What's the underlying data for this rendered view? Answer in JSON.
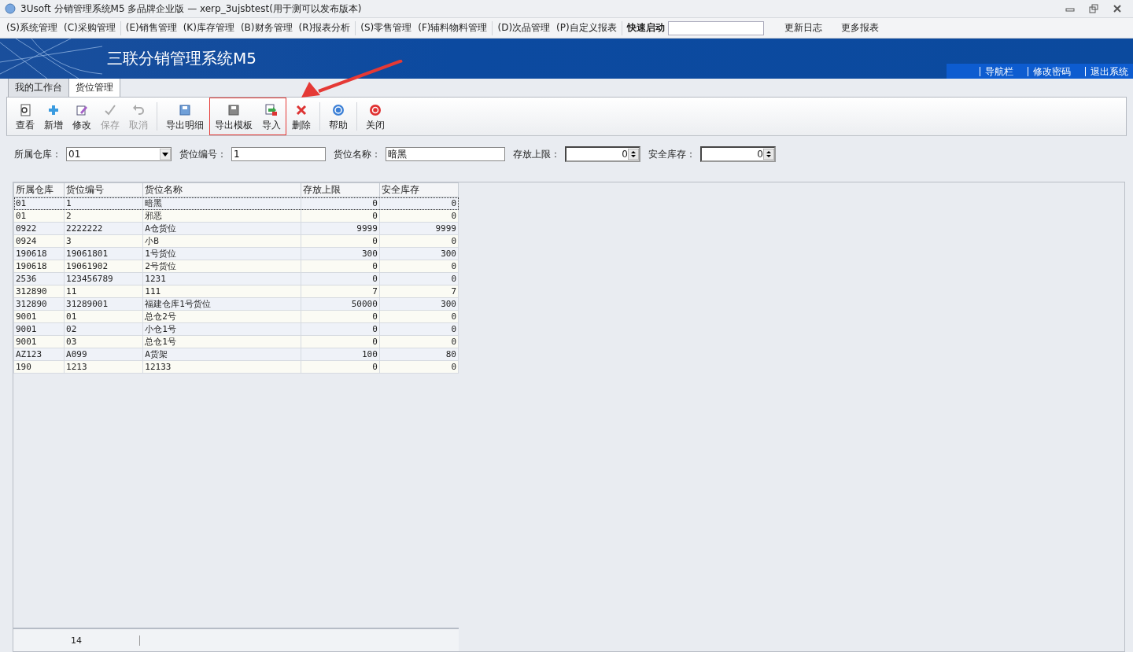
{
  "window": {
    "title": "3Usoft 分销管理系统M5 多品牌企业版 — xerp_3ujsbtest(用于测可以发布版本)"
  },
  "menu": {
    "items": [
      {
        "label": "(S)系统管理"
      },
      {
        "label": "(C)采购管理"
      },
      {
        "label": "(E)销售管理"
      },
      {
        "label": "(K)库存管理"
      },
      {
        "label": "(B)财务管理"
      },
      {
        "label": "(R)报表分析"
      },
      {
        "label": "(S)零售管理"
      },
      {
        "label": "(F)辅料物料管理"
      },
      {
        "label": "(D)次品管理"
      },
      {
        "label": "(P)自定义报表"
      }
    ],
    "quick_launch": {
      "label": "快速启动"
    },
    "links": [
      "更新日志",
      "更多报表"
    ]
  },
  "banner": {
    "title": "三联分销管理系统M5",
    "links": [
      "导航栏",
      "修改密码",
      "退出系统"
    ]
  },
  "tabs": [
    {
      "label": "我的工作台",
      "selected": false
    },
    {
      "label": "货位管理",
      "selected": true
    }
  ],
  "toolbar": {
    "groups": [
      {
        "highlighted": false,
        "buttons": [
          {
            "label": "查看",
            "kind": "view",
            "disabled": false
          },
          {
            "label": "新增",
            "kind": "add",
            "disabled": false
          },
          {
            "label": "修改",
            "kind": "edit",
            "disabled": false
          },
          {
            "label": "保存",
            "kind": "save",
            "disabled": true
          },
          {
            "label": "取消",
            "kind": "undo",
            "disabled": true
          }
        ]
      },
      {
        "highlighted": false,
        "buttons": [
          {
            "label": "导出明细",
            "kind": "disk",
            "disabled": false
          }
        ]
      },
      {
        "highlighted": true,
        "buttons": [
          {
            "label": "导出模板",
            "kind": "disk-grey",
            "disabled": false
          },
          {
            "label": "导入",
            "kind": "import",
            "disabled": false
          }
        ]
      },
      {
        "highlighted": false,
        "buttons": [
          {
            "label": "删除",
            "kind": "delete",
            "disabled": false
          }
        ]
      },
      {
        "highlighted": false,
        "buttons": [
          {
            "label": "帮助",
            "kind": "help",
            "disabled": false
          }
        ]
      },
      {
        "highlighted": false,
        "buttons": [
          {
            "label": "关闭",
            "kind": "power",
            "disabled": false
          }
        ]
      }
    ]
  },
  "filters": [
    {
      "label": "所属仓库：",
      "kind": "select",
      "value": "01"
    },
    {
      "label": "货位编号：",
      "kind": "text",
      "value": "1"
    },
    {
      "label": "货位名称：",
      "kind": "text",
      "value": "暗黑"
    },
    {
      "label": "存放上限：",
      "kind": "spin",
      "value": "0"
    },
    {
      "label": "安全库存：",
      "kind": "spin",
      "value": "0"
    }
  ],
  "table": {
    "columns": [
      "所属仓库",
      "货位编号",
      "货位名称",
      "存放上限",
      "安全库存"
    ],
    "rows": [
      {
        "cells": [
          "01",
          "1",
          "暗黑",
          "0",
          "0"
        ],
        "selected": true
      },
      {
        "cells": [
          "01",
          "2",
          "邪恶",
          "0",
          "0"
        ],
        "selected": false
      },
      {
        "cells": [
          "0922",
          "2222222",
          "A仓货位",
          "9999",
          "9999"
        ],
        "selected": false
      },
      {
        "cells": [
          "0924",
          "3",
          "小B",
          "0",
          "0"
        ],
        "selected": false
      },
      {
        "cells": [
          "190618",
          "19061801",
          "1号货位",
          "300",
          "300"
        ],
        "selected": false
      },
      {
        "cells": [
          "190618",
          "19061902",
          "2号货位",
          "0",
          "0"
        ],
        "selected": false
      },
      {
        "cells": [
          "2536",
          "123456789",
          "1231",
          "0",
          "0"
        ],
        "selected": false
      },
      {
        "cells": [
          "312890",
          "11",
          "111",
          "7",
          "7"
        ],
        "selected": false
      },
      {
        "cells": [
          "312890",
          "31289001",
          "福建仓库1号货位",
          "50000",
          "300"
        ],
        "selected": false
      },
      {
        "cells": [
          "9001",
          "01",
          "总仓2号",
          "0",
          "0"
        ],
        "selected": false
      },
      {
        "cells": [
          "9001",
          "02",
          "小仓1号",
          "0",
          "0"
        ],
        "selected": false
      },
      {
        "cells": [
          "9001",
          "03",
          "总仓1号",
          "0",
          "0"
        ],
        "selected": false
      },
      {
        "cells": [
          "AZ123",
          "A099",
          "A货架",
          "100",
          "80"
        ],
        "selected": false
      },
      {
        "cells": [
          "190",
          "1213",
          "12133",
          "0",
          "0"
        ],
        "selected": false
      }
    ],
    "footer": {
      "count": "14"
    }
  }
}
